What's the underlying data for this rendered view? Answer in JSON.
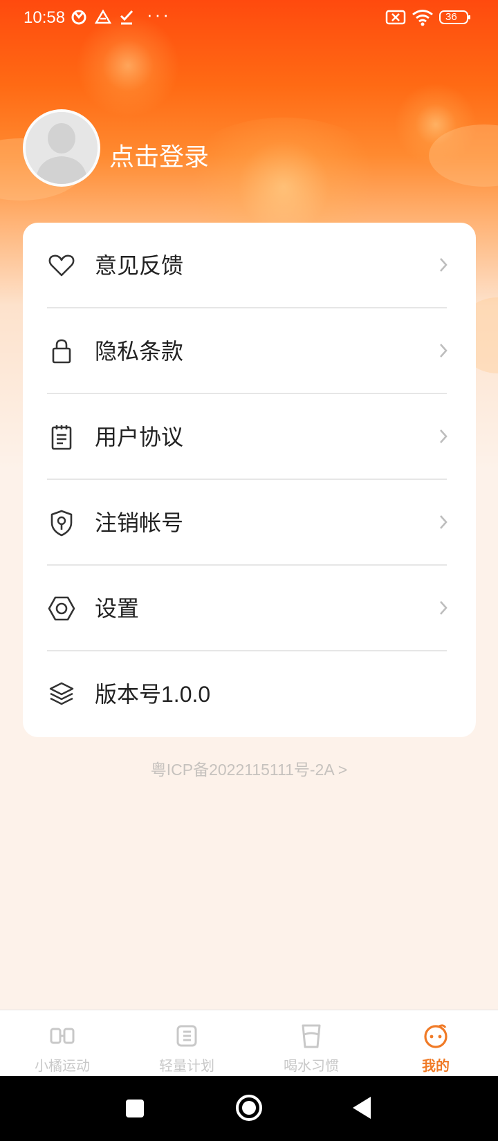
{
  "status_bar": {
    "time": "10:58",
    "more": "···",
    "battery": "36"
  },
  "profile": {
    "login_text": "点击登录"
  },
  "menu": {
    "items": [
      {
        "label": "意见反馈",
        "icon": "heart-icon"
      },
      {
        "label": "隐私条款",
        "icon": "lock-icon"
      },
      {
        "label": "用户协议",
        "icon": "clipboard-icon"
      },
      {
        "label": "注销帐号",
        "icon": "shield-key-icon"
      },
      {
        "label": "设置",
        "icon": "hexagon-settings-icon"
      },
      {
        "label": "版本号1.0.0",
        "icon": "layers-icon"
      }
    ]
  },
  "footer": {
    "icp": "粤ICP备2022115111号-2A >"
  },
  "tabbar": {
    "tabs": [
      {
        "label": "小橘运动",
        "icon": "sport-icon",
        "active": false
      },
      {
        "label": "轻量计划",
        "icon": "plan-icon",
        "active": false
      },
      {
        "label": "喝水习惯",
        "icon": "water-cup-icon",
        "active": false
      },
      {
        "label": "我的",
        "icon": "face-icon",
        "active": true
      }
    ]
  },
  "colors": {
    "accent": "#f07a26",
    "header_top": "#ff4a0e",
    "background": "#fdf2ea",
    "tab_inactive": "#c8c8c8"
  }
}
